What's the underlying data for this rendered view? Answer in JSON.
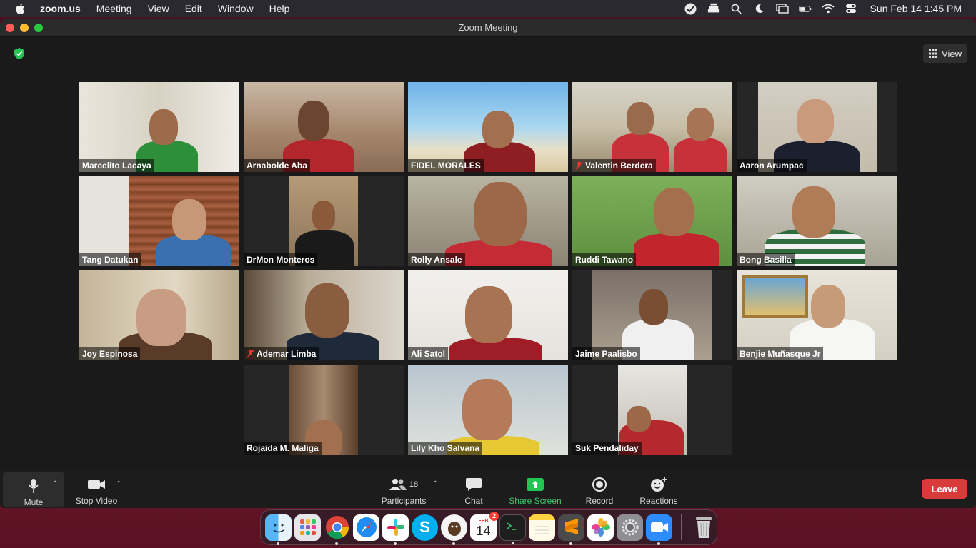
{
  "menubar": {
    "app_name": "zoom.us",
    "items": [
      "Meeting",
      "View",
      "Edit",
      "Window",
      "Help"
    ],
    "clock": "Sun Feb 14  1:45 PM"
  },
  "window": {
    "title": "Zoom Meeting",
    "view_label": "View"
  },
  "participants": [
    {
      "name": "Marcelito Lacaya",
      "muted": false
    },
    {
      "name": "Arnabolde Aba",
      "muted": false
    },
    {
      "name": "FIDEL MORALES",
      "muted": false
    },
    {
      "name": "Valentin Berdera",
      "muted": true
    },
    {
      "name": "Aaron Arumpac",
      "muted": false
    },
    {
      "name": "Tang Datukan",
      "muted": false
    },
    {
      "name": "DrMon Monteros",
      "muted": false
    },
    {
      "name": "Rolly Ansale",
      "muted": false
    },
    {
      "name": "Ruddi Tawano",
      "muted": false
    },
    {
      "name": "Bong Basilla",
      "muted": false
    },
    {
      "name": "Joy Espinosa",
      "muted": false
    },
    {
      "name": "Ademar Limba",
      "muted": true
    },
    {
      "name": "Ali Satol",
      "muted": false
    },
    {
      "name": "Jaime Paalisbo",
      "muted": false
    },
    {
      "name": "Benjie Muñasque Jr",
      "muted": false
    },
    {
      "name": "Rojaida M. Maliga",
      "muted": false
    },
    {
      "name": "Lily Kho Salvana",
      "muted": false,
      "active_speaker": true
    },
    {
      "name": "Suk Pendaliday",
      "muted": false
    }
  ],
  "toolbar": {
    "mute_label": "Mute",
    "stop_video_label": "Stop Video",
    "participants_label": "Participants",
    "participants_count": "18",
    "chat_label": "Chat",
    "share_label": "Share Screen",
    "record_label": "Record",
    "reactions_label": "Reactions",
    "leave_label": "Leave"
  },
  "dock": {
    "apps": [
      "finder",
      "launchpad",
      "chrome",
      "safari",
      "slack",
      "skype",
      "app-7",
      "calendar",
      "terminal",
      "notes",
      "sublime-text",
      "photos",
      "system-preferences",
      "zoom",
      "trash"
    ],
    "calendar_month": "FEB",
    "calendar_day": "14",
    "calendar_badge": "2"
  },
  "colors": {
    "active_speaker_border": "#d4e87a",
    "share_green": "#3cc46e",
    "leave_red": "#d93a3a",
    "shield_green": "#23c552"
  }
}
